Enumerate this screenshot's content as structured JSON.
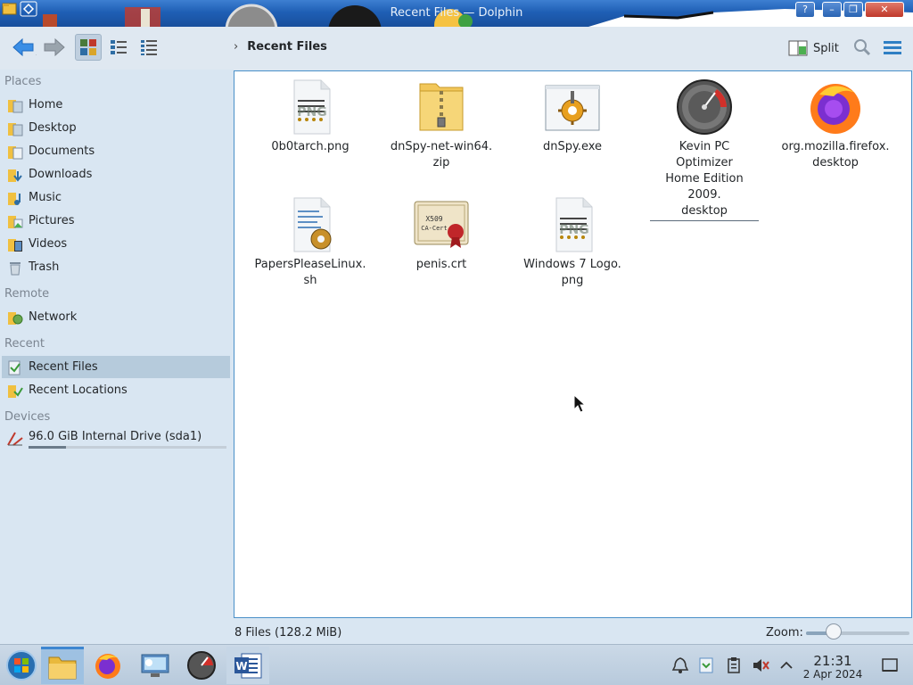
{
  "window": {
    "title": "Recent Files — Dolphin",
    "help_glyph": "?",
    "minimize_glyph": "–",
    "maximize_glyph": "❐",
    "close_glyph": "✕"
  },
  "toolbar": {
    "breadcrumb_chevron": "›",
    "breadcrumb": "Recent Files",
    "split_label": "Split",
    "view_modes": [
      "icons",
      "compact",
      "details"
    ],
    "active_view_mode": "icons"
  },
  "sidebar": {
    "sections": {
      "places": "Places",
      "remote": "Remote",
      "recent": "Recent",
      "devices": "Devices"
    },
    "places": [
      {
        "label": "Home",
        "icon": "home-folder-icon"
      },
      {
        "label": "Desktop",
        "icon": "desktop-folder-icon"
      },
      {
        "label": "Documents",
        "icon": "documents-folder-icon"
      },
      {
        "label": "Downloads",
        "icon": "downloads-folder-icon"
      },
      {
        "label": "Music",
        "icon": "music-folder-icon"
      },
      {
        "label": "Pictures",
        "icon": "pictures-folder-icon"
      },
      {
        "label": "Videos",
        "icon": "videos-folder-icon"
      },
      {
        "label": "Trash",
        "icon": "trash-icon"
      }
    ],
    "remote": [
      {
        "label": "Network",
        "icon": "network-folder-icon"
      }
    ],
    "recent": [
      {
        "label": "Recent Files",
        "icon": "recent-files-icon",
        "selected": true
      },
      {
        "label": "Recent Locations",
        "icon": "recent-locations-icon"
      }
    ],
    "devices": [
      {
        "label": "96.0 GiB Internal Drive (sda1)",
        "icon": "drive-icon",
        "usage_fraction": 0.19
      }
    ]
  },
  "files": [
    {
      "name_line1": "0b0tarch.png",
      "name_line2": "",
      "icon": "png-image-icon"
    },
    {
      "name_line1": "dnSpy-net-win64.",
      "name_line2": "zip",
      "icon": "zip-archive-icon"
    },
    {
      "name_line1": "dnSpy.exe",
      "name_line2": "",
      "icon": "exe-app-icon"
    },
    {
      "name_line1": "Kevin PC Optimizer",
      "name_line2": "Home Edition 2009.",
      "name_line3": "desktop",
      "icon": "gauge-icon"
    },
    {
      "name_line1": "org.mozilla.firefox.",
      "name_line2": "desktop",
      "icon": "firefox-icon"
    },
    {
      "name_line1": "PapersPleaseLinux.",
      "name_line2": "sh",
      "icon": "shell-script-icon"
    },
    {
      "name_line1": "penis.crt",
      "name_line2": "",
      "icon": "certificate-icon"
    },
    {
      "name_line1": "Windows 7 Logo.",
      "name_line2": "png",
      "icon": "png-image-icon"
    }
  ],
  "status": {
    "summary": "8 Files (128.2 MiB)",
    "zoom_label": "Zoom:",
    "zoom_fraction": 0.27
  },
  "taskbar": {
    "apps": [
      "start-orb",
      "file-manager",
      "firefox",
      "remote-desktop",
      "optimizer",
      "word"
    ],
    "active_app": "file-manager",
    "clock_time": "21:31",
    "clock_date": "2 Apr 2024"
  },
  "colors": {
    "titlebar": "#1f5fb5",
    "sidebar_bg": "#d9e6f2",
    "selection": "#b6cbdc",
    "view_border": "#4a90c8",
    "taskbar": "#c1d2e3"
  }
}
